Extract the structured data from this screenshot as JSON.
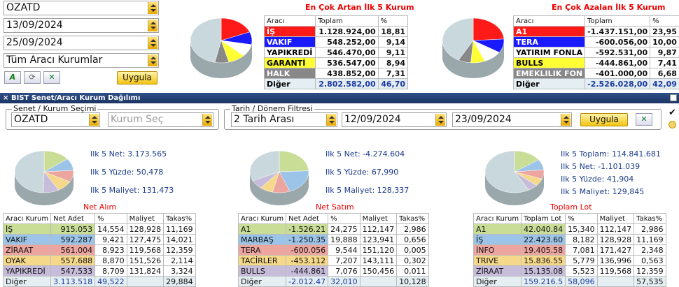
{
  "top": {
    "broker": "OZATD",
    "date1": "13/09/2024",
    "date2": "25/09/2024",
    "filter": "Tüm Aracı Kurumlar",
    "apply": "Uygula",
    "left_title": "En Çok Artan İlk 5 Kurum",
    "right_title": "En Çok Azalan İlk 5 Kurum",
    "col_broker": "Aracı",
    "col_total": "Toplam",
    "col_pct": "%",
    "left_rows": [
      [
        "İŞ",
        "1.128.924,00",
        "18,81"
      ],
      [
        "VAKIF",
        "548.252,00",
        "9,14"
      ],
      [
        "YAPIKREDİ",
        "546.470,00",
        "9,11"
      ],
      [
        "GARANTİ",
        "536.547,00",
        "8,94"
      ],
      [
        "HALK",
        "438.852,00",
        "7,31"
      ],
      [
        "Diğer",
        "2.802.582,00",
        "46,70"
      ]
    ],
    "right_rows": [
      [
        "A1",
        "-1.437.151,00",
        "23,95"
      ],
      [
        "TERA",
        "-600.056,00",
        "10,00"
      ],
      [
        "YATIRIM FONLA",
        "-592.531,00",
        "9,87"
      ],
      [
        "BULLS",
        "-444.861,00",
        "7,41"
      ],
      [
        "EMEKLILIK FON",
        "-401.000,00",
        "6,68"
      ],
      [
        "Diğer",
        "-2.526.028,00",
        "42,09"
      ]
    ],
    "colors": {
      "red": "#ff1a1a",
      "blue": "#1a1aff",
      "white": "#ffffff",
      "yellow": "#ffff33",
      "gray": "#888888",
      "other": "#c8d8dc"
    }
  },
  "panel": {
    "title": "BIST Senet/Aracı Kurum Dağılımı",
    "sec_label": "Senet / Kurum Seçimi",
    "stock": "OZATD",
    "broker_ph": "Kurum Seç",
    "date_label": "Tarih / Dönem Filtresi",
    "period": "2 Tarih Arası",
    "date1": "12/09/2024",
    "date2": "23/09/2024",
    "apply": "Uygula"
  },
  "blocks": [
    {
      "info": [
        "Ilk 5 Net: 3.173.565",
        "Ilk 5 Yüzde: 50,478",
        "Ilk 5 Maliyet: 131,473"
      ],
      "label": "Net Alım",
      "headers": [
        "Aracı Kurum",
        "Net Adet",
        "%",
        "Maliyet",
        "Takas%"
      ],
      "rows": [
        [
          "İŞ",
          "915.053",
          "14,554",
          "128,928",
          "11,169"
        ],
        [
          "VAKIF",
          "592.287",
          "9,421",
          "127,475",
          "14,021"
        ],
        [
          "ZİRAAT",
          "561.004",
          "8,923",
          "119,568",
          "12,359"
        ],
        [
          "OYAK",
          "557.688",
          "8,870",
          "151,526",
          "2,114"
        ],
        [
          "YAPIKREDİ",
          "547.533",
          "8,709",
          "131,824",
          "3,324"
        ],
        [
          "Diğer",
          "3.113.518",
          "49,522",
          "",
          "29,884"
        ]
      ]
    },
    {
      "info": [
        "Ilk 5 Net: -4.274.604",
        "Ilk 5 Yüzde: 67,990",
        "Ilk 5 Maliyet: 128,337"
      ],
      "label": "Net Satım",
      "headers": [
        "Aracı Kurum",
        "Net Adet",
        "%",
        "Maliyet",
        "Takas%"
      ],
      "rows": [
        [
          "A1",
          "-1.526.21",
          "24,275",
          "112,147",
          "2,986"
        ],
        [
          "MARBAŞ",
          "-1.250.35",
          "19,888",
          "123,941",
          "0,656"
        ],
        [
          "TERA",
          "-600.056",
          "9,544",
          "151,120",
          "0,005"
        ],
        [
          "TACİRLER",
          "-453.112",
          "7,207",
          "143,111",
          "0,302"
        ],
        [
          "BULLS",
          "-444.861",
          "7,076",
          "150,456",
          "0,011"
        ],
        [
          "Diğer",
          "-2.012.47",
          "32,010",
          "",
          "10,128"
        ]
      ]
    },
    {
      "info": [
        "Ilk 5 Toplam: 114.841.681",
        "Ilk 5 Net: -1.101.039",
        "Ilk 5 Yüzde: 41,904",
        "Ilk 5 Maliyet: 129,845"
      ],
      "label": "Toplam Lot",
      "headers": [
        "Aracı Kurum",
        "Toplam Lot",
        "%",
        "Maliyet",
        "Takas%"
      ],
      "rows": [
        [
          "A1",
          "42.040.84",
          "15,340",
          "112,147",
          "2,986"
        ],
        [
          "İŞ",
          "22.423.60",
          "8,182",
          "128,928",
          "11,169"
        ],
        [
          "İNFO",
          "19.405.58",
          "7,081",
          "171,427",
          "2,348"
        ],
        [
          "TRIVE",
          "15.836.55",
          "5,779",
          "136,996",
          "0,563"
        ],
        [
          "ZİRAAT",
          "15.135.08",
          "5,523",
          "119,568",
          "12,359"
        ],
        [
          "Diğer",
          "159.216.5",
          "58,096",
          "",
          "57,535"
        ]
      ]
    }
  ],
  "row_colors": [
    "#c9dd97",
    "#9bc4e8",
    "#eda5a0",
    "#f6d88a",
    "#c7bddb",
    "#e4eef3"
  ]
}
